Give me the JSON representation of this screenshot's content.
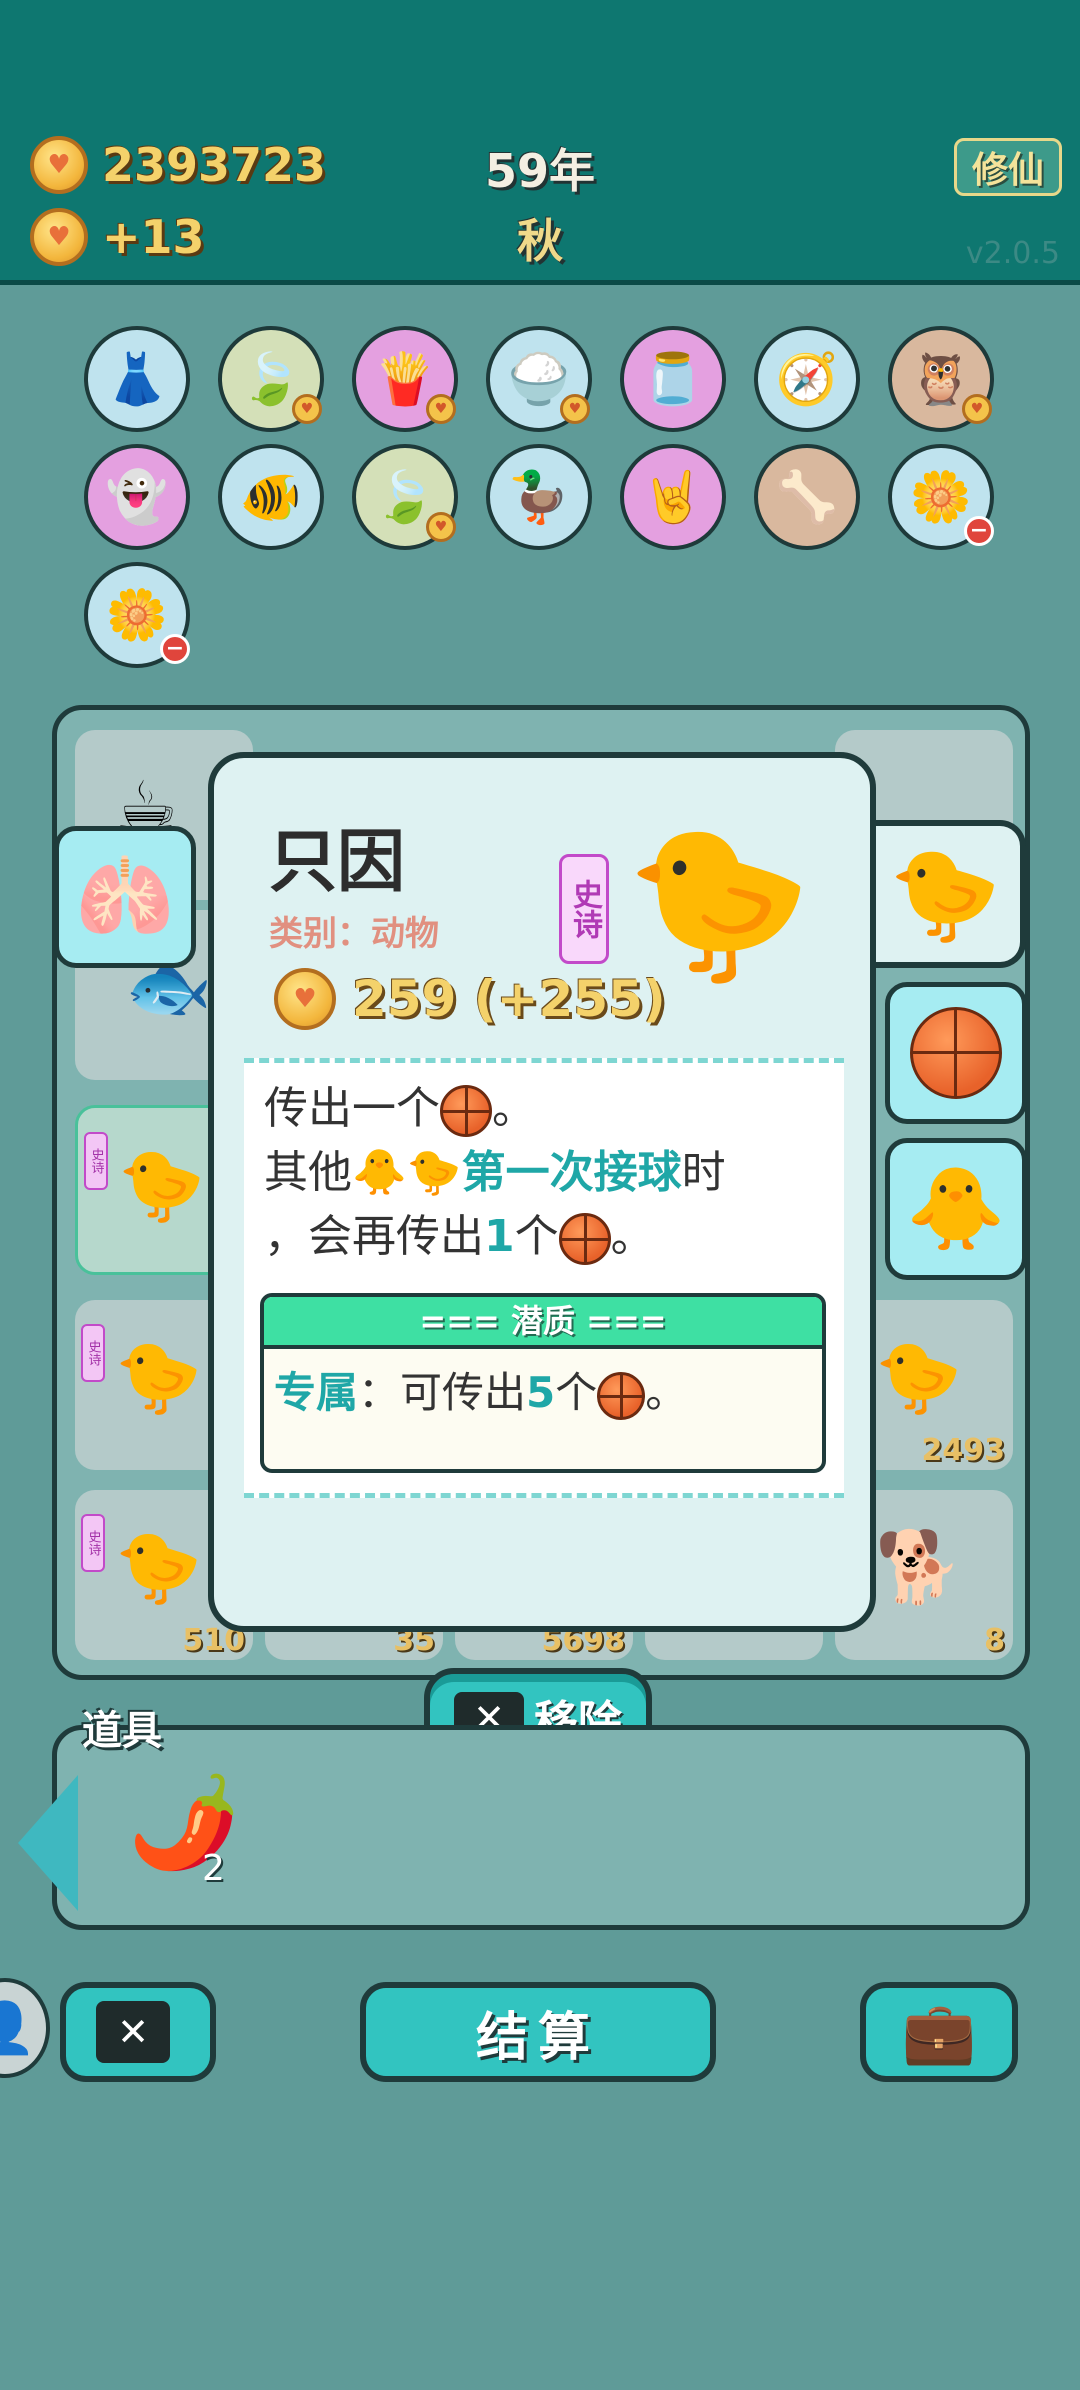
{
  "header": {
    "coins": "2393723",
    "income": "+13",
    "year": "59年",
    "season": "秋",
    "cultivate_label": "修仙",
    "version": "v2.0.5"
  },
  "inventory_items": [
    {
      "name": "skirt",
      "icon": "👗",
      "bg": "#bfe3ee"
    },
    {
      "name": "leaf",
      "icon": "🍃",
      "bg": "#d4e0b8",
      "badge": "coin"
    },
    {
      "name": "fries",
      "icon": "🍟",
      "bg": "#e4a0e0",
      "badge": "coin"
    },
    {
      "name": "rice",
      "icon": "🍚",
      "bg": "#bfe3ee",
      "badge": "coin"
    },
    {
      "name": "jar",
      "icon": "🫙",
      "bg": "#e4a0e0"
    },
    {
      "name": "compass",
      "icon": "🧭",
      "bg": "#bfe3ee"
    },
    {
      "name": "owls",
      "icon": "🦉",
      "bg": "#d9b89e",
      "badge": "coin"
    },
    {
      "name": "ghost",
      "icon": "👻",
      "bg": "#e4a0e0"
    },
    {
      "name": "fishbowl",
      "icon": "🐠",
      "bg": "#bfe3ee"
    },
    {
      "name": "leaf",
      "icon": "🍃",
      "bg": "#d4e0b8",
      "badge": "coin"
    },
    {
      "name": "pot",
      "icon": "🦆",
      "bg": "#bfe3ee"
    },
    {
      "name": "rock-hand",
      "icon": "🤘",
      "bg": "#e4a0e0"
    },
    {
      "name": "dog-bowl",
      "icon": "🦴",
      "bg": "#d9b89e"
    },
    {
      "name": "flower",
      "icon": "🌼",
      "bg": "#bfe3ee",
      "badge": "minus"
    },
    {
      "name": "flower",
      "icon": "🌼",
      "bg": "#bfe3ee",
      "badge": "minus"
    }
  ],
  "board_values": [
    "510",
    "35",
    "5698",
    "8",
    "2493"
  ],
  "board_rarity": "史诗",
  "card": {
    "name": "只因",
    "category": "类别：动物",
    "rarity": "史诗",
    "value": "259 (+255)",
    "desc_1": "传出一个",
    "desc_1_end": "。",
    "desc_2_a": "其他",
    "desc_2_hl": "第一次接球",
    "desc_2_b": "时",
    "desc_3_a": "，会再传出",
    "desc_3_num": "1",
    "desc_3_b": "个",
    "desc_3_end": "。",
    "potential_title": "=== 潜质 ===",
    "potential_label": "专属",
    "potential_text_a": "：可传出",
    "potential_num": "5",
    "potential_text_b": "个",
    "potential_end": "。"
  },
  "actions": {
    "remove_label": "移除",
    "settle_label": "结算"
  },
  "props": {
    "title": "道具",
    "pepper_count": "2"
  },
  "colors": {
    "topbar": "#0e7770",
    "accent": "#32c4c0",
    "gold": "#f4d26b",
    "epic": "#c24ac9"
  }
}
